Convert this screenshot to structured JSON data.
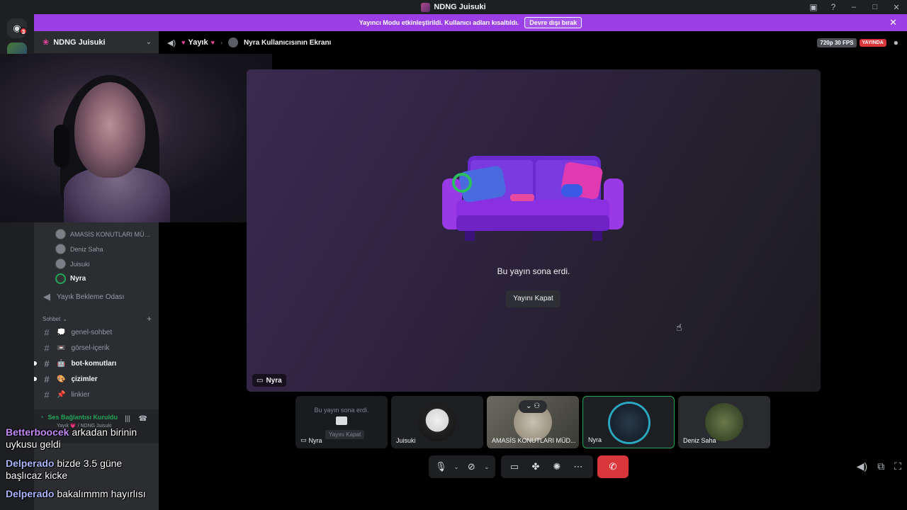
{
  "window": {
    "title": "NDNG Juisuki",
    "minimize": "–",
    "maximize": "□",
    "close": "✕"
  },
  "rail": {
    "dm_badge": "3"
  },
  "banner": {
    "message": "Yayıncı Modu etkinleştirildi. Kullanıcı adları kısaltıldı.",
    "button": "Devre dışı bırak"
  },
  "server": {
    "name": "NDNG Juisuki"
  },
  "voice_users": [
    {
      "name": "AMASİS KONUTLARI MÜD..."
    },
    {
      "name": "Deniz Saha"
    },
    {
      "name": "Juisuki"
    },
    {
      "name": "Nyra"
    }
  ],
  "waiting_room": "Yayık Bekleme Odası",
  "category": "Sohbet",
  "channels": [
    {
      "name": "genel-sohbet",
      "emoji": "💭"
    },
    {
      "name": "görsel-içerik",
      "emoji": "📼"
    },
    {
      "name": "bot-komutları",
      "emoji": "🤖"
    },
    {
      "name": "çizimler",
      "emoji": "🎨"
    },
    {
      "name": "linkier",
      "emoji": "📌"
    }
  ],
  "voice_panel": {
    "status": "Ses Bağlantısı Kuruldu",
    "sub": "Yayık 💗 / NDNG Juisuki"
  },
  "topbar": {
    "channel": "Yayık",
    "screen": "Nyra Kullanıcısının Ekranı",
    "quality": "720p 30 FPS",
    "live": "YAYINDA"
  },
  "stage": {
    "ended_text": "Bu yayın sona erdi.",
    "close_button": "Yayını Kapat",
    "nametag": "Nyra"
  },
  "tiles": [
    {
      "name": "Nyra",
      "ended_text": "Bu yayın sona erdi.",
      "kapat": "Yayını Kapat"
    },
    {
      "name": "Juisuki"
    },
    {
      "name": "AMASİS KONUTLARI MÜD..."
    },
    {
      "name": "Nyra"
    },
    {
      "name": "Deniz Saha"
    }
  ],
  "chat": [
    {
      "user": "Betterboocek",
      "text": "arkadan birinin",
      "cont": "uykusu geldi",
      "color": "#c58af9"
    },
    {
      "user": "Delperado",
      "text": "bizde 3.5 güne",
      "cont": "başlıcaz kicke",
      "color": "#a9b8ff"
    },
    {
      "user": "Delperado",
      "text": "bakalımmm hayırlısı",
      "color": "#a9b8ff"
    }
  ]
}
